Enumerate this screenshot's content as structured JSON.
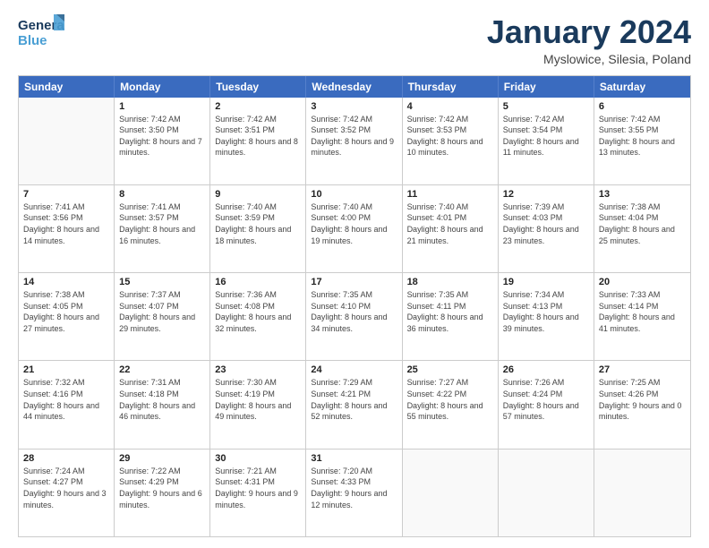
{
  "header": {
    "logo_general": "General",
    "logo_blue": "Blue",
    "month_title": "January 2024",
    "location": "Myslowice, Silesia, Poland"
  },
  "weekdays": [
    "Sunday",
    "Monday",
    "Tuesday",
    "Wednesday",
    "Thursday",
    "Friday",
    "Saturday"
  ],
  "rows": [
    [
      {
        "day": "",
        "sunrise": "",
        "sunset": "",
        "daylight": ""
      },
      {
        "day": "1",
        "sunrise": "Sunrise: 7:42 AM",
        "sunset": "Sunset: 3:50 PM",
        "daylight": "Daylight: 8 hours and 7 minutes."
      },
      {
        "day": "2",
        "sunrise": "Sunrise: 7:42 AM",
        "sunset": "Sunset: 3:51 PM",
        "daylight": "Daylight: 8 hours and 8 minutes."
      },
      {
        "day": "3",
        "sunrise": "Sunrise: 7:42 AM",
        "sunset": "Sunset: 3:52 PM",
        "daylight": "Daylight: 8 hours and 9 minutes."
      },
      {
        "day": "4",
        "sunrise": "Sunrise: 7:42 AM",
        "sunset": "Sunset: 3:53 PM",
        "daylight": "Daylight: 8 hours and 10 minutes."
      },
      {
        "day": "5",
        "sunrise": "Sunrise: 7:42 AM",
        "sunset": "Sunset: 3:54 PM",
        "daylight": "Daylight: 8 hours and 11 minutes."
      },
      {
        "day": "6",
        "sunrise": "Sunrise: 7:42 AM",
        "sunset": "Sunset: 3:55 PM",
        "daylight": "Daylight: 8 hours and 13 minutes."
      }
    ],
    [
      {
        "day": "7",
        "sunrise": "Sunrise: 7:41 AM",
        "sunset": "Sunset: 3:56 PM",
        "daylight": "Daylight: 8 hours and 14 minutes."
      },
      {
        "day": "8",
        "sunrise": "Sunrise: 7:41 AM",
        "sunset": "Sunset: 3:57 PM",
        "daylight": "Daylight: 8 hours and 16 minutes."
      },
      {
        "day": "9",
        "sunrise": "Sunrise: 7:40 AM",
        "sunset": "Sunset: 3:59 PM",
        "daylight": "Daylight: 8 hours and 18 minutes."
      },
      {
        "day": "10",
        "sunrise": "Sunrise: 7:40 AM",
        "sunset": "Sunset: 4:00 PM",
        "daylight": "Daylight: 8 hours and 19 minutes."
      },
      {
        "day": "11",
        "sunrise": "Sunrise: 7:40 AM",
        "sunset": "Sunset: 4:01 PM",
        "daylight": "Daylight: 8 hours and 21 minutes."
      },
      {
        "day": "12",
        "sunrise": "Sunrise: 7:39 AM",
        "sunset": "Sunset: 4:03 PM",
        "daylight": "Daylight: 8 hours and 23 minutes."
      },
      {
        "day": "13",
        "sunrise": "Sunrise: 7:38 AM",
        "sunset": "Sunset: 4:04 PM",
        "daylight": "Daylight: 8 hours and 25 minutes."
      }
    ],
    [
      {
        "day": "14",
        "sunrise": "Sunrise: 7:38 AM",
        "sunset": "Sunset: 4:05 PM",
        "daylight": "Daylight: 8 hours and 27 minutes."
      },
      {
        "day": "15",
        "sunrise": "Sunrise: 7:37 AM",
        "sunset": "Sunset: 4:07 PM",
        "daylight": "Daylight: 8 hours and 29 minutes."
      },
      {
        "day": "16",
        "sunrise": "Sunrise: 7:36 AM",
        "sunset": "Sunset: 4:08 PM",
        "daylight": "Daylight: 8 hours and 32 minutes."
      },
      {
        "day": "17",
        "sunrise": "Sunrise: 7:35 AM",
        "sunset": "Sunset: 4:10 PM",
        "daylight": "Daylight: 8 hours and 34 minutes."
      },
      {
        "day": "18",
        "sunrise": "Sunrise: 7:35 AM",
        "sunset": "Sunset: 4:11 PM",
        "daylight": "Daylight: 8 hours and 36 minutes."
      },
      {
        "day": "19",
        "sunrise": "Sunrise: 7:34 AM",
        "sunset": "Sunset: 4:13 PM",
        "daylight": "Daylight: 8 hours and 39 minutes."
      },
      {
        "day": "20",
        "sunrise": "Sunrise: 7:33 AM",
        "sunset": "Sunset: 4:14 PM",
        "daylight": "Daylight: 8 hours and 41 minutes."
      }
    ],
    [
      {
        "day": "21",
        "sunrise": "Sunrise: 7:32 AM",
        "sunset": "Sunset: 4:16 PM",
        "daylight": "Daylight: 8 hours and 44 minutes."
      },
      {
        "day": "22",
        "sunrise": "Sunrise: 7:31 AM",
        "sunset": "Sunset: 4:18 PM",
        "daylight": "Daylight: 8 hours and 46 minutes."
      },
      {
        "day": "23",
        "sunrise": "Sunrise: 7:30 AM",
        "sunset": "Sunset: 4:19 PM",
        "daylight": "Daylight: 8 hours and 49 minutes."
      },
      {
        "day": "24",
        "sunrise": "Sunrise: 7:29 AM",
        "sunset": "Sunset: 4:21 PM",
        "daylight": "Daylight: 8 hours and 52 minutes."
      },
      {
        "day": "25",
        "sunrise": "Sunrise: 7:27 AM",
        "sunset": "Sunset: 4:22 PM",
        "daylight": "Daylight: 8 hours and 55 minutes."
      },
      {
        "day": "26",
        "sunrise": "Sunrise: 7:26 AM",
        "sunset": "Sunset: 4:24 PM",
        "daylight": "Daylight: 8 hours and 57 minutes."
      },
      {
        "day": "27",
        "sunrise": "Sunrise: 7:25 AM",
        "sunset": "Sunset: 4:26 PM",
        "daylight": "Daylight: 9 hours and 0 minutes."
      }
    ],
    [
      {
        "day": "28",
        "sunrise": "Sunrise: 7:24 AM",
        "sunset": "Sunset: 4:27 PM",
        "daylight": "Daylight: 9 hours and 3 minutes."
      },
      {
        "day": "29",
        "sunrise": "Sunrise: 7:22 AM",
        "sunset": "Sunset: 4:29 PM",
        "daylight": "Daylight: 9 hours and 6 minutes."
      },
      {
        "day": "30",
        "sunrise": "Sunrise: 7:21 AM",
        "sunset": "Sunset: 4:31 PM",
        "daylight": "Daylight: 9 hours and 9 minutes."
      },
      {
        "day": "31",
        "sunrise": "Sunrise: 7:20 AM",
        "sunset": "Sunset: 4:33 PM",
        "daylight": "Daylight: 9 hours and 12 minutes."
      },
      {
        "day": "",
        "sunrise": "",
        "sunset": "",
        "daylight": ""
      },
      {
        "day": "",
        "sunrise": "",
        "sunset": "",
        "daylight": ""
      },
      {
        "day": "",
        "sunrise": "",
        "sunset": "",
        "daylight": ""
      }
    ]
  ]
}
